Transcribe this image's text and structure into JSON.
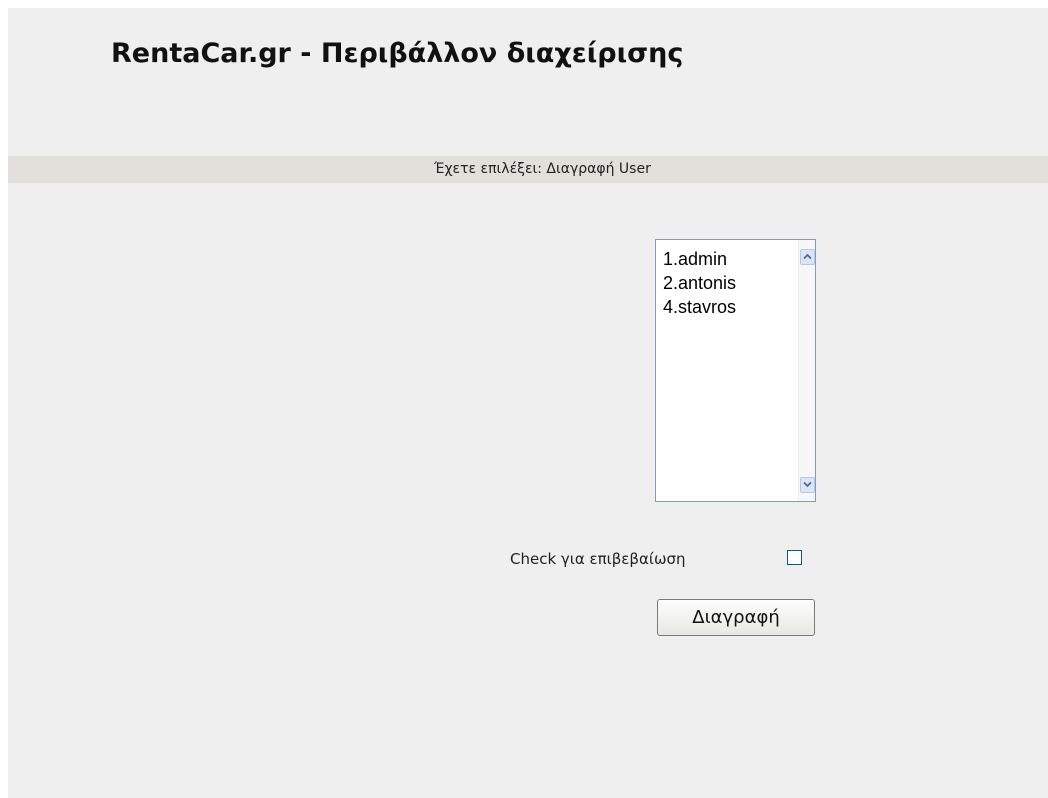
{
  "header": {
    "title": "RentaCar.gr - Περιβάλλον διαχείρισης"
  },
  "status": {
    "text": "Έχετε επιλέξει: Διαγραφή User"
  },
  "user_list": {
    "items": [
      "1.admin",
      "2.antonis",
      "4.stavros"
    ]
  },
  "confirm": {
    "label": "Check για επιβεβαίωση",
    "checked": false
  },
  "actions": {
    "delete_label": "Διαγραφή"
  },
  "colors": {
    "page_background": "#efefef",
    "status_bar": "#e3dfdb",
    "list_border": "#7f9db9",
    "checkbox_border": "#1c5180"
  },
  "icons": {
    "scroll_up": "chevron-up-icon",
    "scroll_down": "chevron-down-icon"
  }
}
